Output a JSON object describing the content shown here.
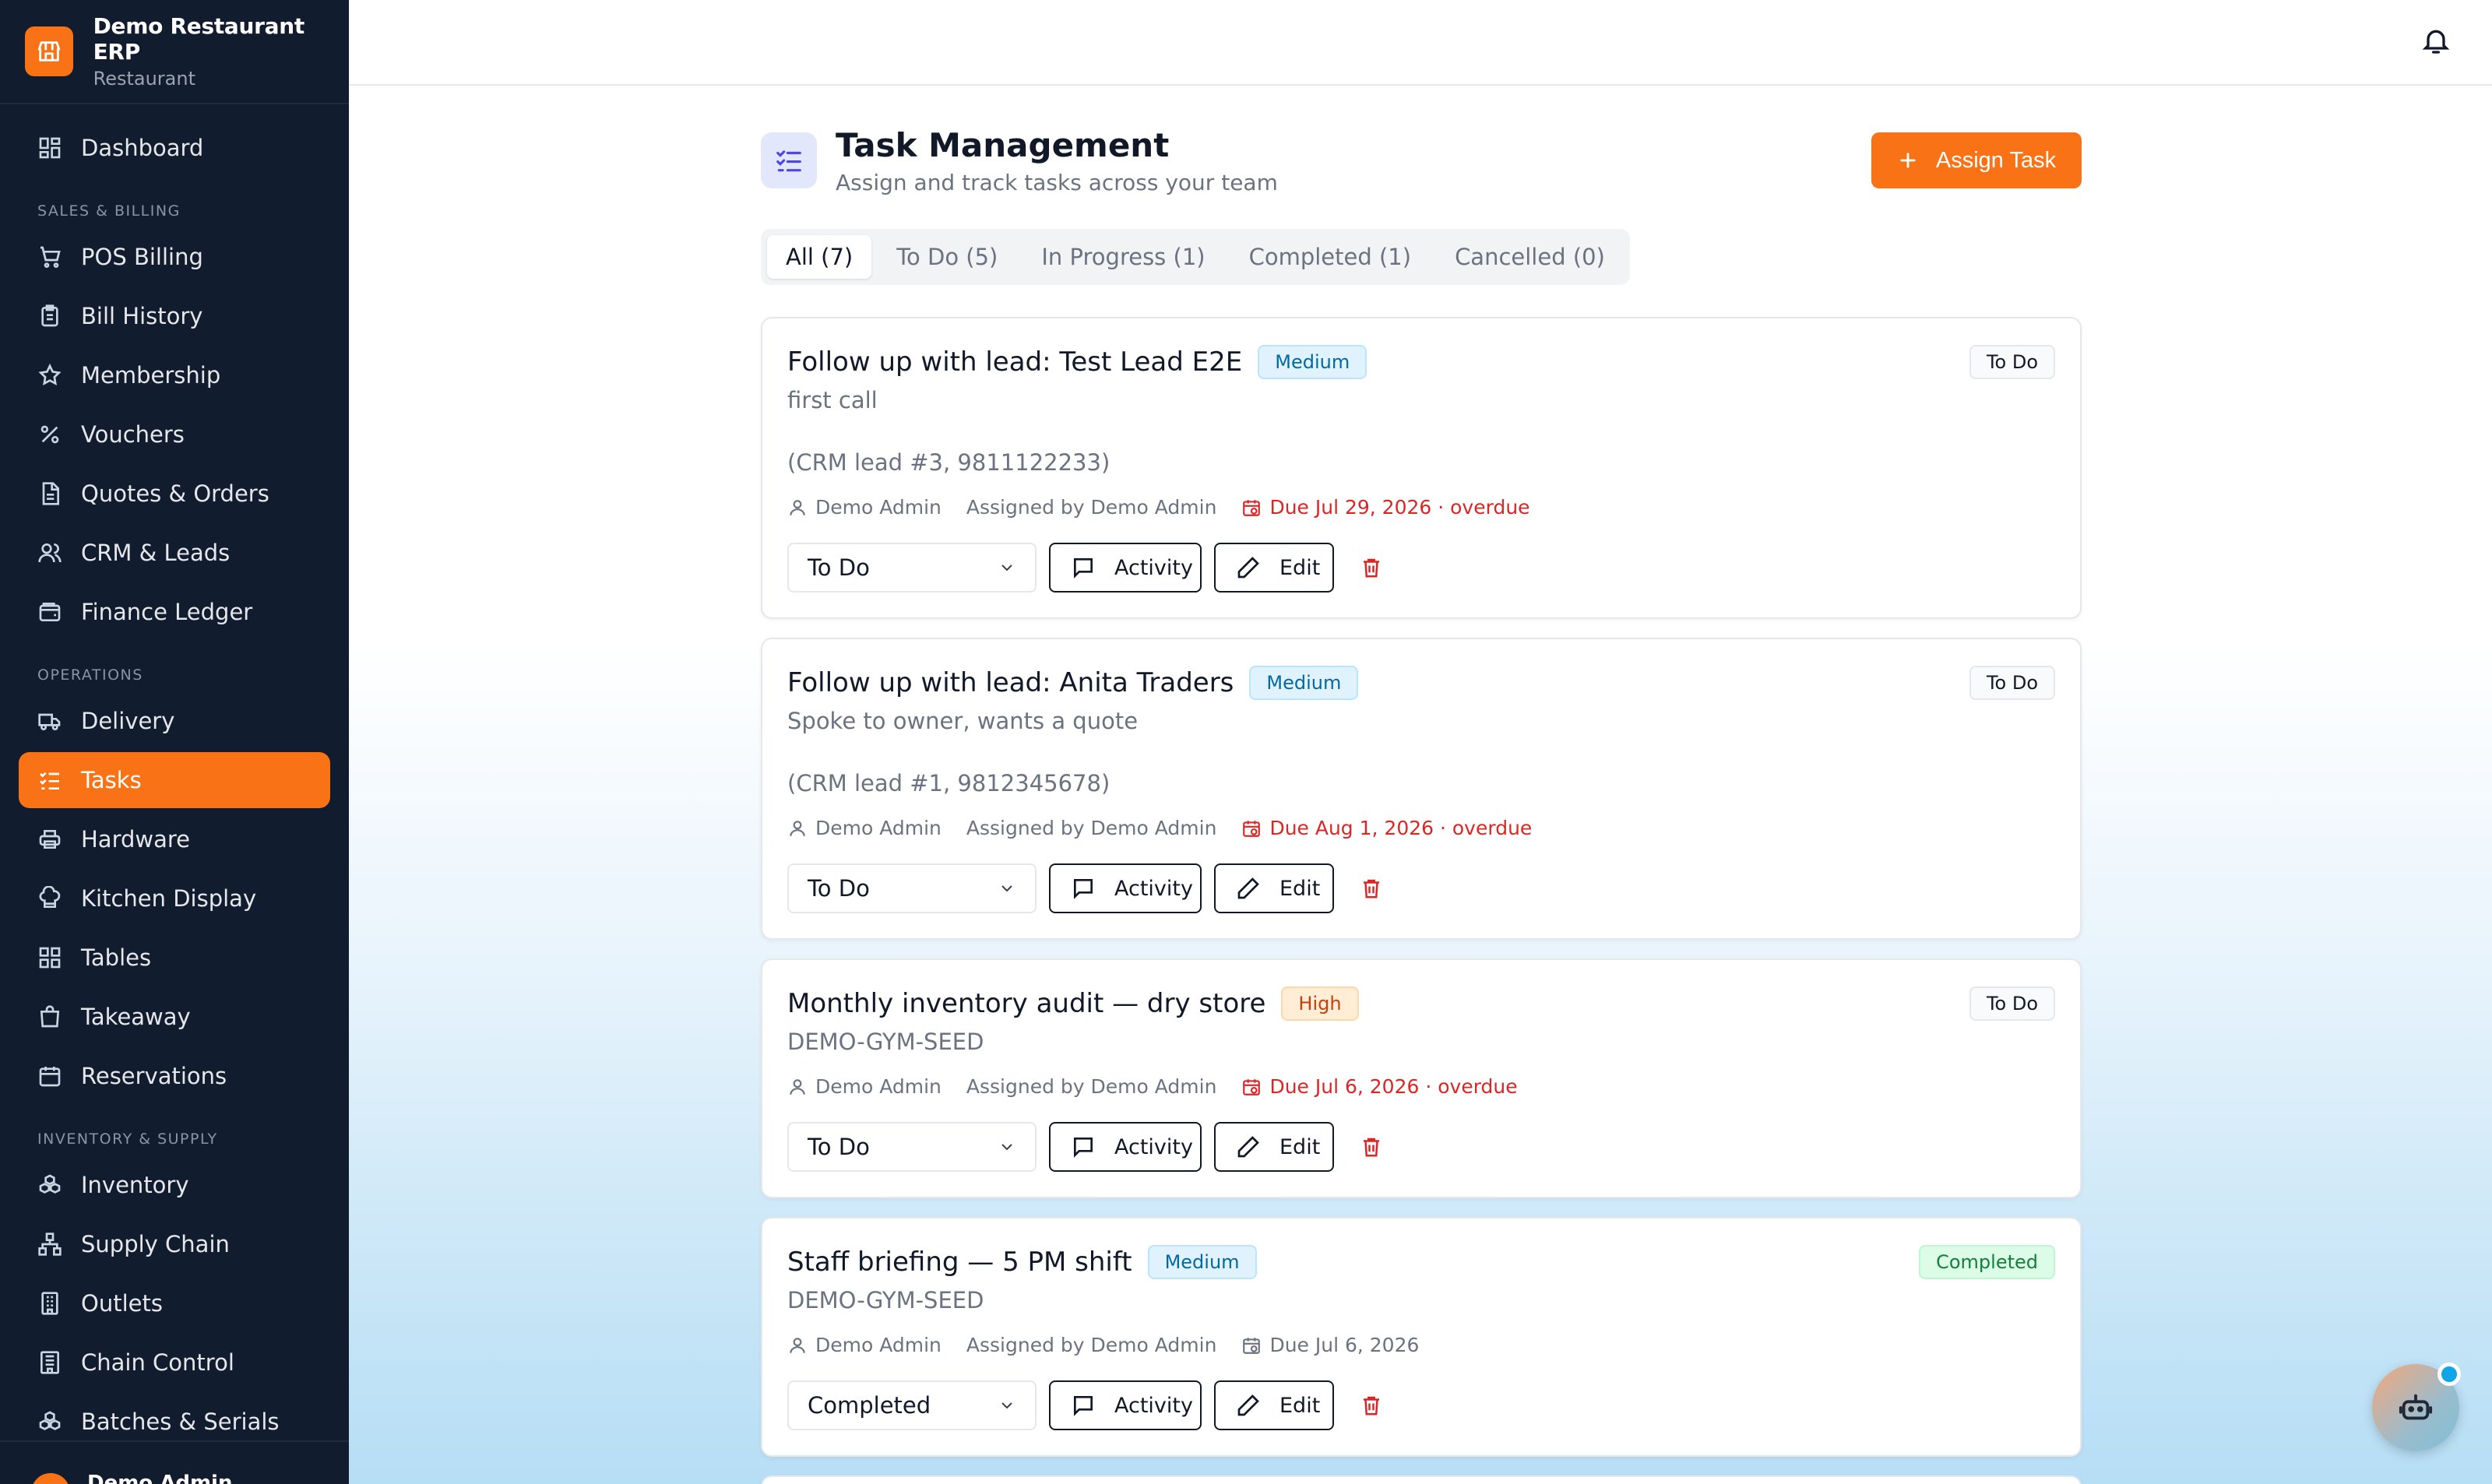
{
  "brand": {
    "title": "Demo Restaurant ERP",
    "subtitle": "Restaurant"
  },
  "sidebar": {
    "dashboard": "Dashboard",
    "sections": [
      {
        "label": "SALES & BILLING",
        "items": [
          "POS Billing",
          "Bill History",
          "Membership",
          "Vouchers",
          "Quotes & Orders",
          "CRM & Leads",
          "Finance Ledger"
        ]
      },
      {
        "label": "OPERATIONS",
        "items": [
          "Delivery",
          "Tasks",
          "Hardware",
          "Kitchen Display",
          "Tables",
          "Takeaway",
          "Reservations"
        ]
      },
      {
        "label": "INVENTORY & SUPPLY",
        "items": [
          "Inventory",
          "Supply Chain",
          "Outlets",
          "Chain Control",
          "Batches & Serials"
        ]
      }
    ],
    "active_item": "Tasks",
    "footer_user": "Demo Admin"
  },
  "page": {
    "title": "Task Management",
    "subtitle": "Assign and track tasks across your team",
    "assign_button": "Assign Task"
  },
  "tabs": [
    "All (7)",
    "To Do (5)",
    "In Progress (1)",
    "Completed (1)",
    "Cancelled (0)"
  ],
  "active_tab": "All (7)",
  "colors": {
    "accent": "#f97316",
    "sidebar_bg": "#111c2e",
    "overdue": "#dc2626",
    "completed": "#15803d"
  },
  "tasks": [
    {
      "title": "Follow up with lead: Test Lead E2E",
      "priority": "Medium",
      "status_badge": "To Do",
      "description": "first call",
      "note": "(CRM lead #3, 9811122233)",
      "assignee": "Demo Admin",
      "assigned_by": "Assigned by Demo Admin",
      "due": "Due Jul 29, 2026 · overdue",
      "status_select": "To Do",
      "activity_label": "Activity",
      "edit_label": "Edit"
    },
    {
      "title": "Follow up with lead: Anita Traders",
      "priority": "Medium",
      "status_badge": "To Do",
      "description": "Spoke to owner, wants a quote",
      "note": "(CRM lead #1, 9812345678)",
      "assignee": "Demo Admin",
      "assigned_by": "Assigned by Demo Admin",
      "due": "Due Aug 1, 2026 · overdue",
      "status_select": "To Do",
      "activity_label": "Activity",
      "edit_label": "Edit"
    },
    {
      "title": "Monthly inventory audit — dry store",
      "priority": "High",
      "status_badge": "To Do",
      "description": "DEMO-GYM-SEED",
      "assignee": "Demo Admin",
      "assigned_by": "Assigned by Demo Admin",
      "due": "Due Jul 6, 2026 · overdue",
      "status_select": "To Do",
      "activity_label": "Activity",
      "edit_label": "Edit"
    },
    {
      "title": "Staff briefing — 5 PM shift",
      "priority": "Medium",
      "status_badge": "Completed",
      "description": "DEMO-GYM-SEED",
      "assignee": "Demo Admin",
      "assigned_by": "Assigned by Demo Admin",
      "due": "Due Jul 6, 2026",
      "status_select": "Completed",
      "activity_label": "Activity",
      "edit_label": "Edit"
    }
  ]
}
